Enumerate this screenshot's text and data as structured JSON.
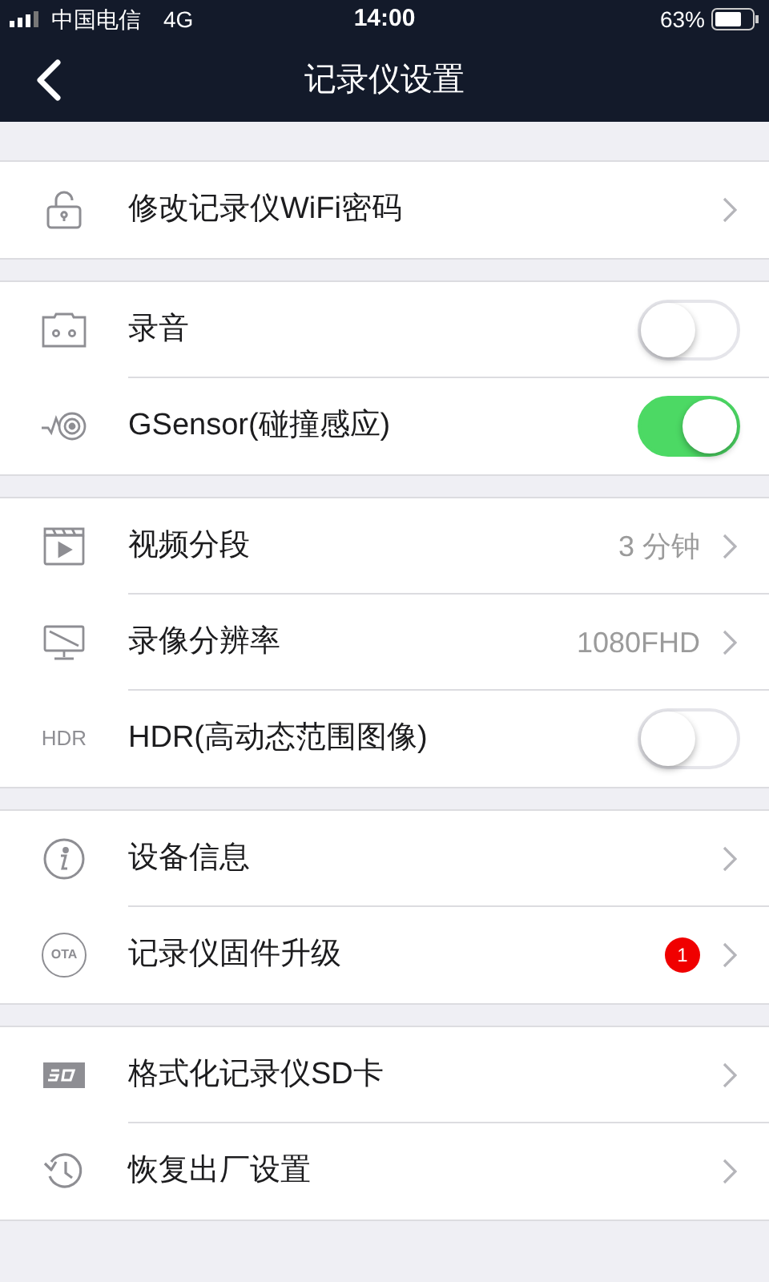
{
  "status_bar": {
    "carrier": "中国电信",
    "network": "4G",
    "time": "14:00",
    "battery": "63%"
  },
  "nav": {
    "title": "记录仪设置"
  },
  "groups": [
    {
      "rows": [
        {
          "label": "修改记录仪WiFi密码",
          "kind": "chevron"
        }
      ]
    },
    {
      "rows": [
        {
          "label": "录音",
          "kind": "toggle",
          "on": false
        },
        {
          "label": "GSensor(碰撞感应)",
          "kind": "toggle",
          "on": true
        }
      ]
    },
    {
      "rows": [
        {
          "label": "视频分段",
          "kind": "chevron",
          "value": "3 分钟"
        },
        {
          "label": "录像分辨率",
          "kind": "chevron",
          "value": "1080FHD"
        },
        {
          "label": "HDR(高动态范围图像)",
          "kind": "toggle",
          "on": false,
          "icon_text": "HDR"
        }
      ]
    },
    {
      "rows": [
        {
          "label": "设备信息",
          "kind": "chevron"
        },
        {
          "label": "记录仪固件升级",
          "kind": "chevron",
          "badge": "1",
          "icon_label": "OTA"
        }
      ]
    },
    {
      "rows": [
        {
          "label": "格式化记录仪SD卡",
          "kind": "chevron"
        },
        {
          "label": "恢复出厂设置",
          "kind": "chevron"
        }
      ]
    }
  ]
}
